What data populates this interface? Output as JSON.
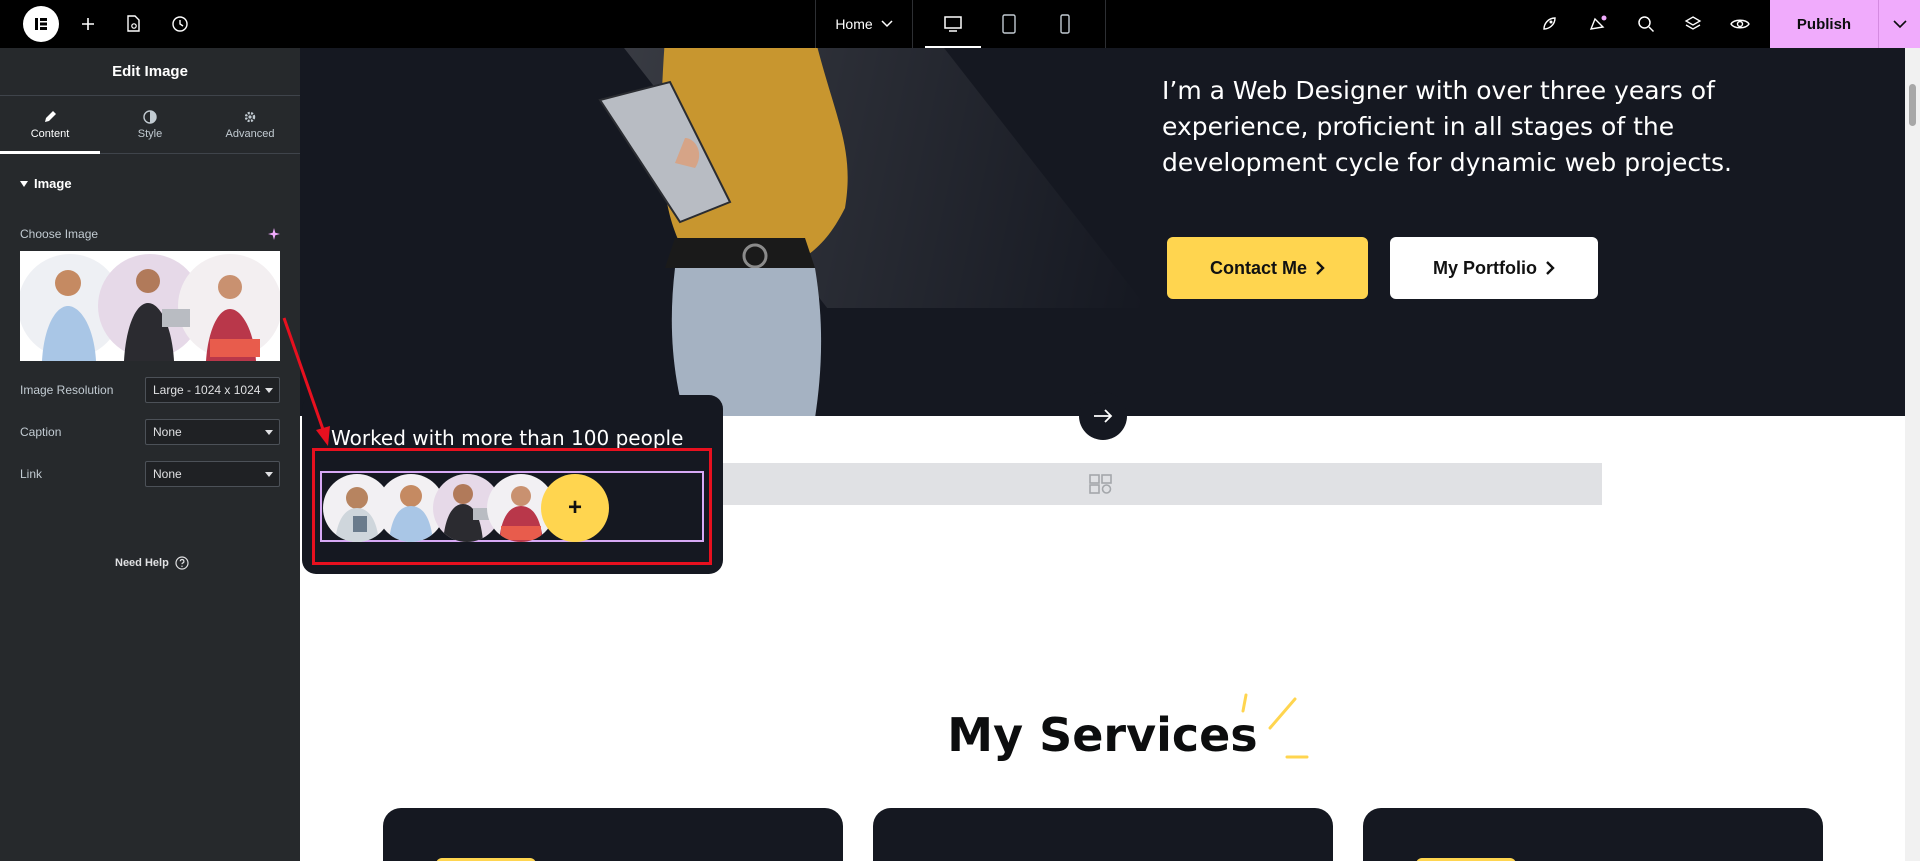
{
  "topbar": {
    "page_name": "Home",
    "publish_label": "Publish",
    "colors": {
      "bar": "#000000",
      "publish": "#f0abfc"
    }
  },
  "panel": {
    "title": "Edit Image",
    "tabs": [
      {
        "label": "Content",
        "icon": "pencil-icon",
        "active": true
      },
      {
        "label": "Style",
        "icon": "half-circle-icon",
        "active": false
      },
      {
        "label": "Advanced",
        "icon": "gear-icon",
        "active": false
      }
    ],
    "section_title": "Image",
    "choose_image_label": "Choose Image",
    "resolution": {
      "label": "Image Resolution",
      "value": "Large - 1024 x 1024"
    },
    "caption": {
      "label": "Caption",
      "value": "None"
    },
    "link": {
      "label": "Link",
      "value": "None"
    },
    "need_help": "Need Help"
  },
  "canvas": {
    "hero_text": "I’m a Web Designer with over three years of experience, proficient in all stages of the development cycle for dynamic web projects.",
    "contact_button": "Contact Me",
    "portfolio_button": "My Portfolio",
    "worked_with": "Worked with more than 100 people",
    "plus_label": "+",
    "services_heading": "My Services",
    "colors": {
      "hero_bg": "#151821",
      "accent_yellow": "#ffd54f",
      "annotation_red": "#e8101f"
    }
  }
}
